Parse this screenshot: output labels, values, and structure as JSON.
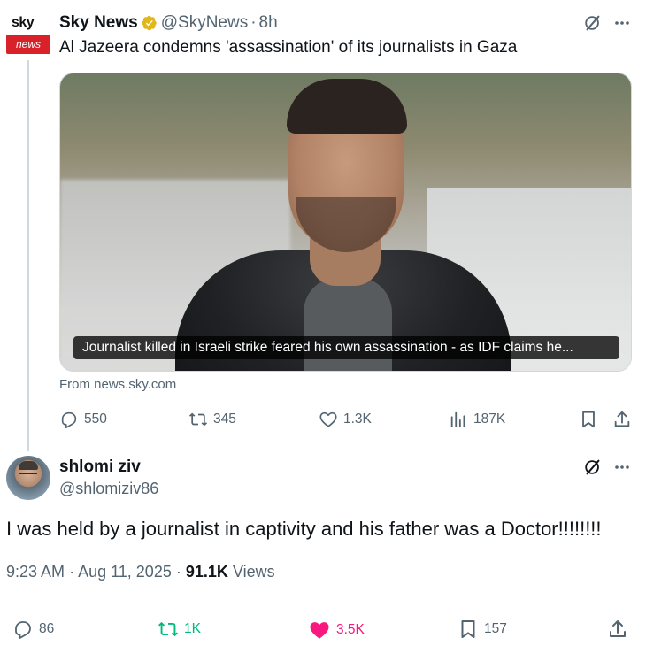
{
  "quoted_tweet": {
    "logo_top": "sky",
    "logo_badge": "news",
    "author_name": "Sky News",
    "handle": "@SkyNews",
    "separator": "·",
    "time": "8h",
    "text": "Al Jazeera condemns 'assassination' of its journalists in Gaza",
    "card_caption": "Journalist killed in Israeli strike feared his own assassination - as IDF claims he...",
    "card_source": "From news.sky.com",
    "replies": "550",
    "reposts": "345",
    "likes": "1.3K",
    "views": "187K"
  },
  "main_tweet": {
    "author_name": "shlomi ziv",
    "handle": "@shlomiziv86",
    "text": "I was held by a journalist in captivity and his father was a Doctor!!!!!!!!",
    "time": "9:23 AM",
    "separator": "·",
    "date": "Aug 11, 2025",
    "views_count": "91.1K",
    "views_label": "Views",
    "replies": "86",
    "reposts": "1K",
    "likes": "3.5K",
    "bookmarks": "157"
  },
  "colors": {
    "text_primary": "#0f1419",
    "text_secondary": "#536471",
    "retweet_active": "#00ba7c",
    "like_active": "#f91880",
    "verified_gold": "#e2b719",
    "sky_red": "#d9212a"
  },
  "icons": [
    "grok-icon",
    "more-icon",
    "reply-icon",
    "repost-icon",
    "like-icon",
    "views-icon",
    "bookmark-icon",
    "share-icon",
    "verified-icon"
  ]
}
